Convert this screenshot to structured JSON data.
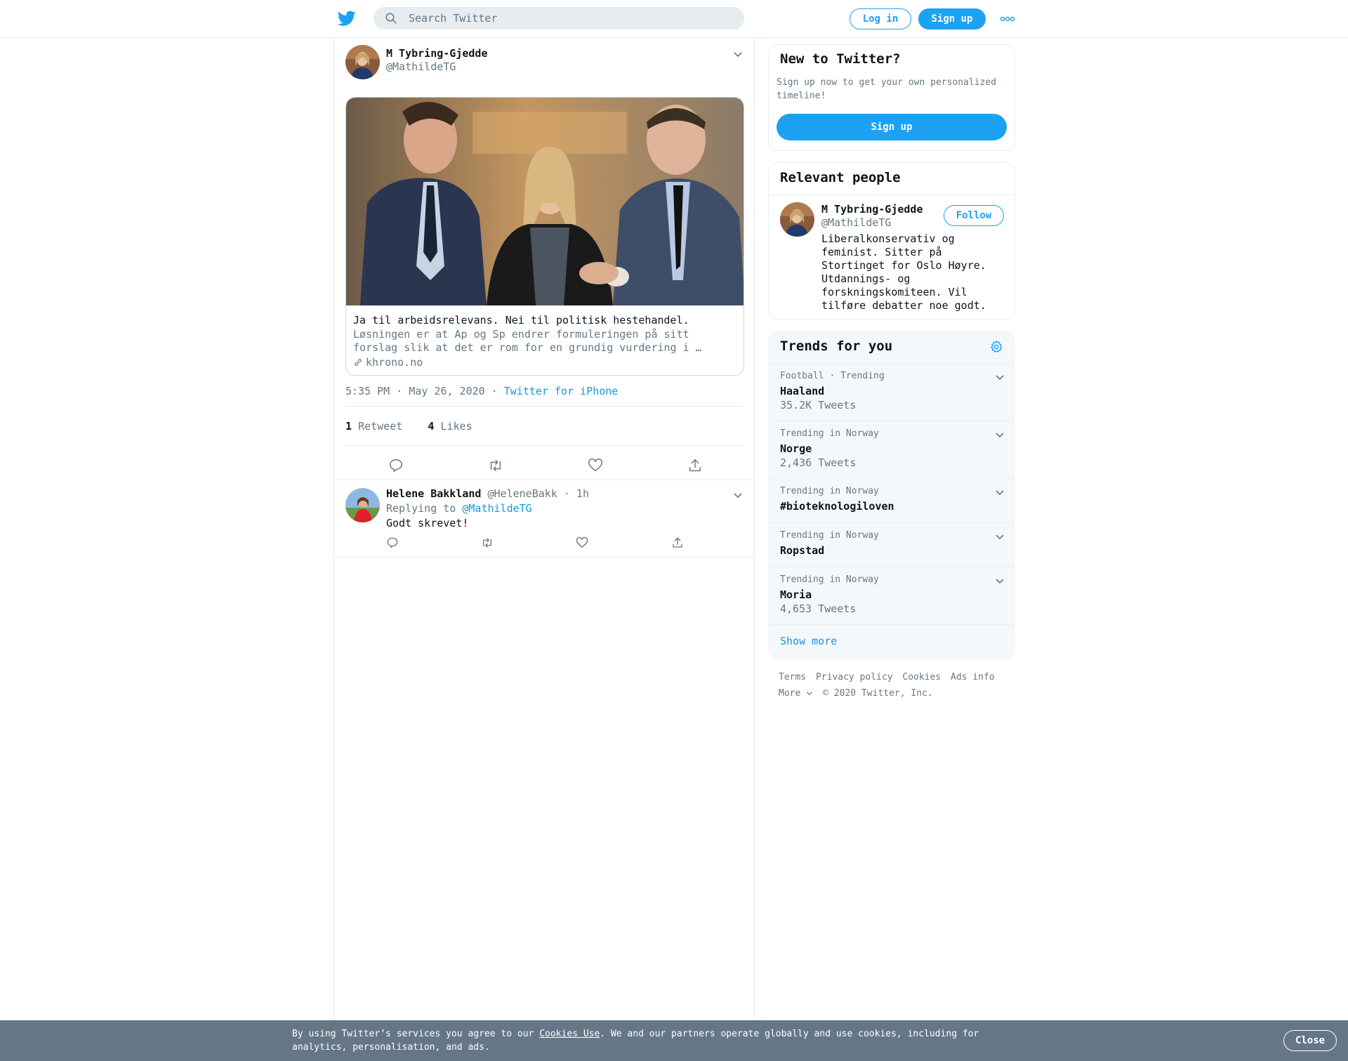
{
  "header": {
    "search_placeholder": "Search Twitter",
    "login_label": "Log in",
    "signup_label": "Sign up"
  },
  "tweet": {
    "author_name": "M Tybring-Gjedde",
    "author_handle": "@MathildeTG",
    "card": {
      "title": "Ja til arbeidsrelevans. Nei til politisk hestehandel.",
      "description": "Løsningen er at Ap og Sp endrer formuleringen på sitt forslag slik at det er rom for en grundig vurdering i …",
      "domain": "khrono.no"
    },
    "timestamp": "5:35 PM · May 26, 2020",
    "separator": "·",
    "source": "Twitter for iPhone",
    "retweet_count": "1",
    "retweet_label": "Retweet",
    "like_count": "4",
    "like_label": "Likes"
  },
  "reply": {
    "author_name": "Helene Bakkland",
    "author_handle": "@HeleneBakk",
    "time": "· 1h",
    "replying_prefix": "Replying to",
    "replying_to": "@MathildeTG",
    "text": "Godt skrevet!"
  },
  "sidebar": {
    "new_to_twitter": {
      "title": "New to Twitter?",
      "description": "Sign up now to get your own personalized timeline!",
      "signup_label": "Sign up"
    },
    "relevant_people": {
      "title": "Relevant people",
      "name": "M Tybring-Gjedde",
      "handle": "@MathildeTG",
      "follow_label": "Follow",
      "bio": "Liberalkonservativ og feminist. Sitter på Stortinget for Oslo Høyre. Utdannings- og forskningskomiteen. Vil tilføre debatter noe godt."
    },
    "trends": {
      "title": "Trends for you",
      "items": [
        {
          "context": "Football · Trending",
          "name": "Haaland",
          "count": "35.2K Tweets"
        },
        {
          "context": "Trending in Norway",
          "name": "Norge",
          "count": "2,436 Tweets"
        },
        {
          "context": "Trending in Norway",
          "name": "#bioteknologiloven",
          "count": ""
        },
        {
          "context": "Trending in Norway",
          "name": "Ropstad",
          "count": ""
        },
        {
          "context": "Trending in Norway",
          "name": "Moria",
          "count": "4,653 Tweets"
        }
      ],
      "show_more": "Show more"
    },
    "footer": {
      "terms": "Terms",
      "privacy": "Privacy policy",
      "cookies": "Cookies",
      "ads": "Ads info",
      "more": "More",
      "copyright": "© 2020 Twitter, Inc."
    }
  },
  "cookie_bar": {
    "text_before": "By using Twitter’s services you agree to our",
    "link": "Cookies Use",
    "text_after": ". We and our partners operate globally and use cookies, including for analytics, personalisation, and ads.",
    "close_label": "Close"
  },
  "colors": {
    "accent": "#1da1f2",
    "link": "#1b95e0",
    "secondary_text": "#657786",
    "cookie_bar": "#657786"
  }
}
